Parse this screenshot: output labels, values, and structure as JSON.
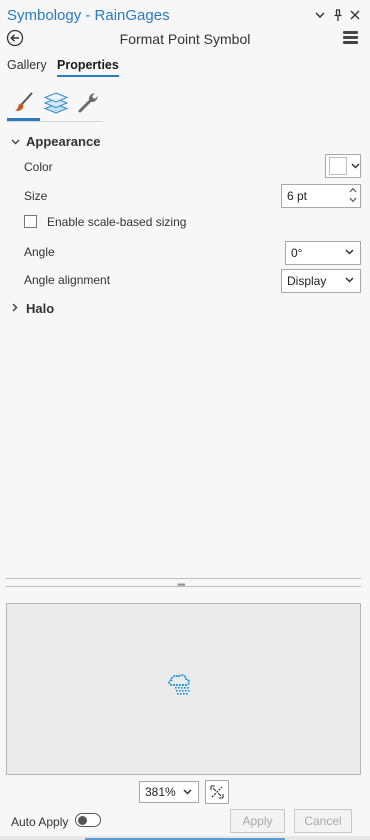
{
  "window": {
    "title": "Symbology - RainGages",
    "subtitle": "Format Point Symbol"
  },
  "tabs": {
    "gallery": "Gallery",
    "properties": "Properties"
  },
  "icon_tabs": [
    "brush-icon",
    "layers-icon",
    "wrench-icon"
  ],
  "appearance": {
    "header": "Appearance",
    "color_label": "Color",
    "color_value": "#ffffff",
    "size_label": "Size",
    "size_value": "6 pt",
    "scale_sizing_label": "Enable scale-based sizing",
    "angle_label": "Angle",
    "angle_value": "0°",
    "alignment_label": "Angle alignment",
    "alignment_value": "Display"
  },
  "halo": {
    "header": "Halo"
  },
  "preview": {
    "zoom": "381%",
    "symbol_color": "#1a8fd6"
  },
  "footer": {
    "auto_apply_label": "Auto Apply",
    "apply_label": "Apply",
    "cancel_label": "Cancel"
  },
  "colors": {
    "accent": "#2b7bbf"
  }
}
